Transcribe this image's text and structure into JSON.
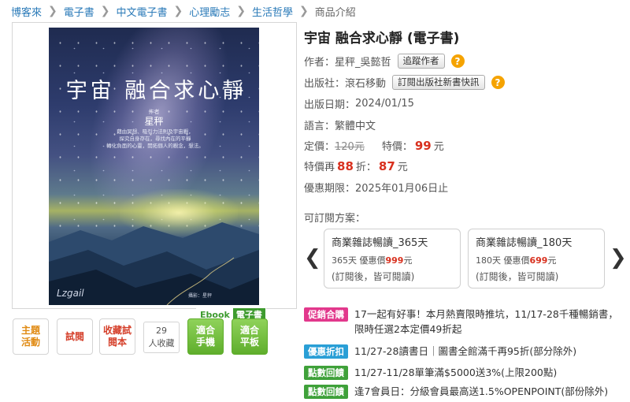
{
  "breadcrumb": {
    "items": [
      "博客來",
      "電子書",
      "中文電子書",
      "心理勵志",
      "生活哲學"
    ],
    "current": "商品介紹",
    "separator": "❯"
  },
  "cover": {
    "title": "宇宙 融合求心靜",
    "author_label": "作者",
    "author": "星秤",
    "tagline": [
      "藉由冥想、吸引力法則及宇宙觀，",
      "探究自身存在，尋找內在的平靜",
      "轉化負面的心靈，開拓個人的觀念，想法。"
    ],
    "credit": "攝影：星秤",
    "logo": "Lzgail"
  },
  "ebook_badge": {
    "en": "Ebook",
    "zh": "電子書"
  },
  "actions": {
    "topic_label": "主題活動",
    "trial_label": "試閱",
    "collect_trial_label": "收藏試閱本",
    "collect_count": "29",
    "collect_text": "人收藏",
    "phone_label": "適合手機",
    "tablet_label": "適合平板"
  },
  "product": {
    "title": "宇宙 融合求心靜 (電子書)",
    "author_label": "作者：",
    "author": "星秤_吳懿哲",
    "follow_author_label": "追蹤作者",
    "publisher_label": "出版社：",
    "publisher": "滾石移動",
    "subscribe_publisher_label": "訂閱出版社新書快訊",
    "date_label": "出版日期：",
    "date": "2024/01/15",
    "language_label": "語言：",
    "language": "繁體中文",
    "list_price_label": "定價：",
    "list_price": "120元",
    "special_price_label": "特價：",
    "special_price": "99",
    "yuan": "元",
    "discount_prefix": "特價再",
    "discount_rate": "88",
    "discount_mid": "折：",
    "discount_price": "87",
    "offer_label": "優惠期限：",
    "offer_period": "2025年01月06日止"
  },
  "subscription": {
    "label": "可訂閱方案：",
    "plans": [
      {
        "name": "商業雜誌暢讀_365天",
        "days": "365天 優惠價",
        "price": "999",
        "unit": "元",
        "note": "(訂閱後，皆可閱讀)"
      },
      {
        "name": "商業雜誌暢讀_180天",
        "days": "180天 優惠價",
        "price": "699",
        "unit": "元",
        "note": "(訂閱後，皆可閱讀)"
      }
    ]
  },
  "promotions": [
    {
      "tag": "促銷合購",
      "text": "17一起有好事！本月熱賣限時推坑，11/17-28千種暢銷書，限時任選2本定價49折起",
      "color": "#e2388c"
    },
    {
      "tag": "優惠折扣",
      "text": "11/27-28讀書日｜圖書全館滿千再95折(部分除外)",
      "color": "#2a9fd6"
    },
    {
      "tag": "點數回饋",
      "text": "11/27-11/28單筆滿$5000送3%(上限200點)",
      "color": "#3fa13a"
    },
    {
      "tag": "點數回饋",
      "text": "逢7會員日：分級會員最高送1.5%OPENPOINT(部份除外)",
      "color": "#3fa13a"
    }
  ],
  "icons": {
    "help": "question-mark-icon",
    "prev": "chevron-left-icon",
    "next": "chevron-right-icon"
  },
  "colors": {
    "link": "#2a7ab8",
    "price": "#d8301e",
    "help": "#f5a300",
    "ebook_green": "#3e9b2f"
  }
}
